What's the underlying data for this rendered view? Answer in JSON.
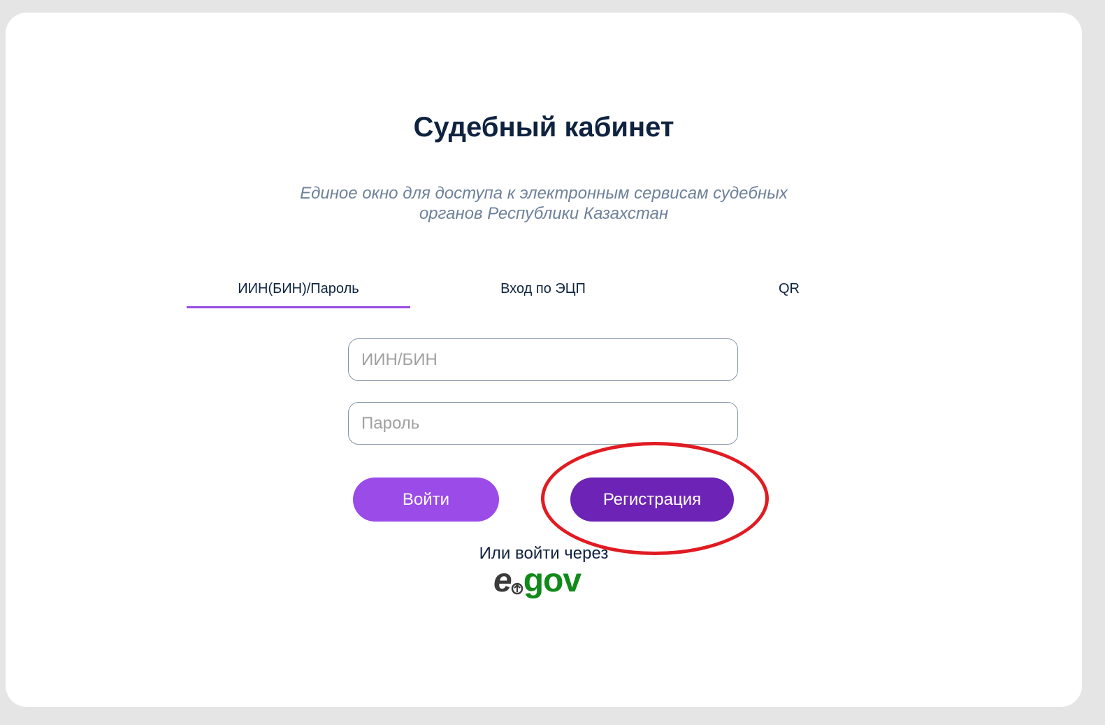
{
  "header": {
    "title": "Судебный кабинет",
    "subtitle_line1": "Единое окно для доступа к электронным сервисам судебных",
    "subtitle_line2": "органов Республики Казахстан"
  },
  "tabs": [
    {
      "label": "ИИН(БИН)/Пароль",
      "active": true
    },
    {
      "label": "Вход по ЭЦП",
      "active": false
    },
    {
      "label": "QR",
      "active": false
    }
  ],
  "form": {
    "iin_placeholder": "ИИН/БИН",
    "password_placeholder": "Пароль",
    "login_label": "Войти",
    "register_label": "Регистрация"
  },
  "alt_login": {
    "text": "Или войти через",
    "egov_e": "e",
    "egov_gov": "gov"
  },
  "colors": {
    "accent": "#9a4be8",
    "accent_dark": "#6d23b6",
    "title": "#0f2340",
    "subtitle": "#6e819a",
    "annotation": "#e11b22",
    "egov_green": "#128a1a"
  }
}
